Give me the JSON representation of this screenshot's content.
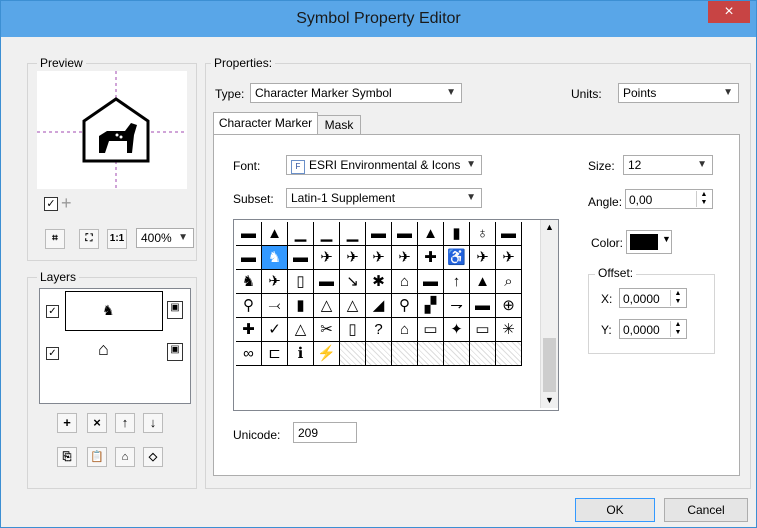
{
  "window": {
    "title": "Symbol Property Editor",
    "close": "×"
  },
  "preview": {
    "group_label": "Preview",
    "zoom": "400%",
    "show_checkbox_checked": true
  },
  "layers": {
    "group_label": "Layers"
  },
  "properties": {
    "group_label": "Properties:",
    "type_label": "Type:",
    "type_value": "Character Marker Symbol",
    "units_label": "Units:",
    "units_value": "Points",
    "tabs": [
      "Character Marker",
      "Mask"
    ],
    "font_label": "Font:",
    "font_value": "ESRI Environmental & Icons",
    "subset_label": "Subset:",
    "subset_value": "Latin-1 Supplement",
    "size_label": "Size:",
    "size_value": "12",
    "angle_label": "Angle:",
    "angle_value": "0,00",
    "color_label": "Color:",
    "color_hex": "#000000",
    "offset_label": "Offset:",
    "x_label": "X:",
    "x_value": "0,0000",
    "y_label": "Y:",
    "y_value": "0,0000",
    "unicode_label": "Unicode:",
    "unicode_value": "209"
  },
  "buttons": {
    "ok": "OK",
    "cancel": "Cancel"
  },
  "glyphs": [
    [
      "▬",
      "▲",
      "▁",
      "▁",
      "▁",
      "▬",
      "▬",
      "▲",
      "▮",
      "♁",
      "▬"
    ],
    [
      "▬",
      "♞",
      "▬",
      "✈",
      "✈",
      "✈",
      "✈",
      "✚",
      "♿",
      "✈",
      "✈"
    ],
    [
      "♞",
      "✈",
      "▯",
      "▬",
      "↘",
      "✱",
      "⌂",
      "▬",
      "↑",
      "▲",
      "⌕"
    ],
    [
      "⚲",
      "⤙",
      "▮",
      "△",
      "△",
      "◢",
      "⚲",
      "▞",
      "⇁",
      "▬",
      "⊕"
    ],
    [
      "✚",
      "✓",
      "△",
      "✂",
      "▯",
      "?",
      "⌂",
      "▭",
      "✦",
      "▭",
      "✳"
    ],
    [
      "∞",
      "⊏",
      "ℹ",
      "⚡",
      "",
      "",
      "",
      "",
      "",
      "",
      ""
    ]
  ],
  "selected_glyph": "♞"
}
